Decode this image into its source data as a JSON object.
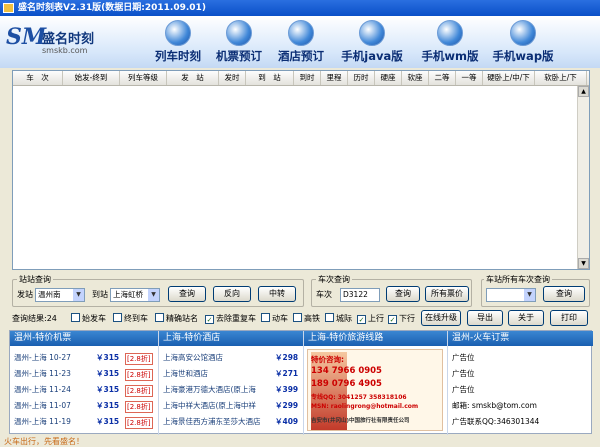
{
  "window": {
    "title": "盛名时刻表V2.31版(数据日期:2011.09.01)"
  },
  "logo": {
    "mark": "SM",
    "name": "盛名时刻",
    "url": "smskb.com"
  },
  "nav": [
    "列车时刻",
    "机票预订",
    "酒店预订",
    "手机java版",
    "手机wm版",
    "手机wap版"
  ],
  "columns": [
    "车　次",
    "始发-终到",
    "列车等级",
    "发　站",
    "发时",
    "到　站",
    "到时",
    "里程",
    "历时",
    "硬座",
    "软座",
    "二等",
    "一等",
    "硬卧上/中/下",
    "软卧上/下"
  ],
  "station_query": {
    "legend": "站站查询",
    "from_label": "发站",
    "from_value": "温州南",
    "to_label": "到站",
    "to_value": "上海虹桥",
    "query": "查询",
    "reverse": "反向",
    "transfer": "中转"
  },
  "train_query": {
    "legend": "车次查询",
    "label": "车次",
    "value": "D3122",
    "query": "查询",
    "all_prices": "所有票价"
  },
  "station_all": {
    "legend": "车站所有车次查询",
    "value": "",
    "query": "查询"
  },
  "filters": {
    "result": "查询结果:24",
    "options": [
      {
        "label": "始发车",
        "checked": false
      },
      {
        "label": "终到车",
        "checked": false
      },
      {
        "label": "精确站名",
        "checked": false
      },
      {
        "label": "去除重复车",
        "checked": true
      },
      {
        "label": "动车",
        "checked": false
      },
      {
        "label": "高铁",
        "checked": false
      },
      {
        "label": "城际",
        "checked": false
      },
      {
        "label": "上行",
        "checked": true
      },
      {
        "label": "下行",
        "checked": true
      }
    ],
    "upgrade": "在线升级",
    "export": "导出",
    "about": "关于",
    "print": "打印"
  },
  "flights": {
    "title": "温州-特价机票",
    "rows": [
      {
        "route": "温州-上海",
        "date": "10-27",
        "price": "￥315",
        "discount": "[2.8折]"
      },
      {
        "route": "温州-上海",
        "date": "11-23",
        "price": "￥315",
        "discount": "[2.8折]"
      },
      {
        "route": "温州-上海",
        "date": "11-24",
        "price": "￥315",
        "discount": "[2.8折]"
      },
      {
        "route": "温州-上海",
        "date": "11-07",
        "price": "￥315",
        "discount": "[2.8折]"
      },
      {
        "route": "温州-上海",
        "date": "11-19",
        "price": "￥315",
        "discount": "[2.8折]"
      }
    ]
  },
  "hotels": {
    "title": "上海-特价酒店",
    "rows": [
      {
        "name": "上海高安公馆酒店",
        "price": "￥298"
      },
      {
        "name": "上海世和酒店",
        "price": "￥271"
      },
      {
        "name": "上海豪港万德大酒店(原上海",
        "price": "￥399"
      },
      {
        "name": "上海中祥大酒店(原上海中祥",
        "price": "￥299"
      },
      {
        "name": "上海景佳西方浦东圣莎大酒店",
        "price": "￥409"
      }
    ]
  },
  "tours": {
    "title": "上海-特价旅游线路",
    "ad": {
      "consult": "特价咨询:",
      "phone1": "134 7966 0905",
      "phone2": "189 0796 4905",
      "qq": "专线QQ: 3041257 358318106",
      "msn": "MSN: raolingrong@hotmail.com",
      "company": "吉安市(井冈山)中国旅行社有限责任公司"
    }
  },
  "train_tickets": {
    "title": "温州-火车订票",
    "rows": [
      "广告位",
      "广告位",
      "广告位"
    ],
    "email_label": "邮箱:",
    "email": "smskb@tom.com",
    "ad_qq_label": "广告联系QQ:",
    "ad_qq": "346301344"
  },
  "status": "火车出行，先看盛名！"
}
